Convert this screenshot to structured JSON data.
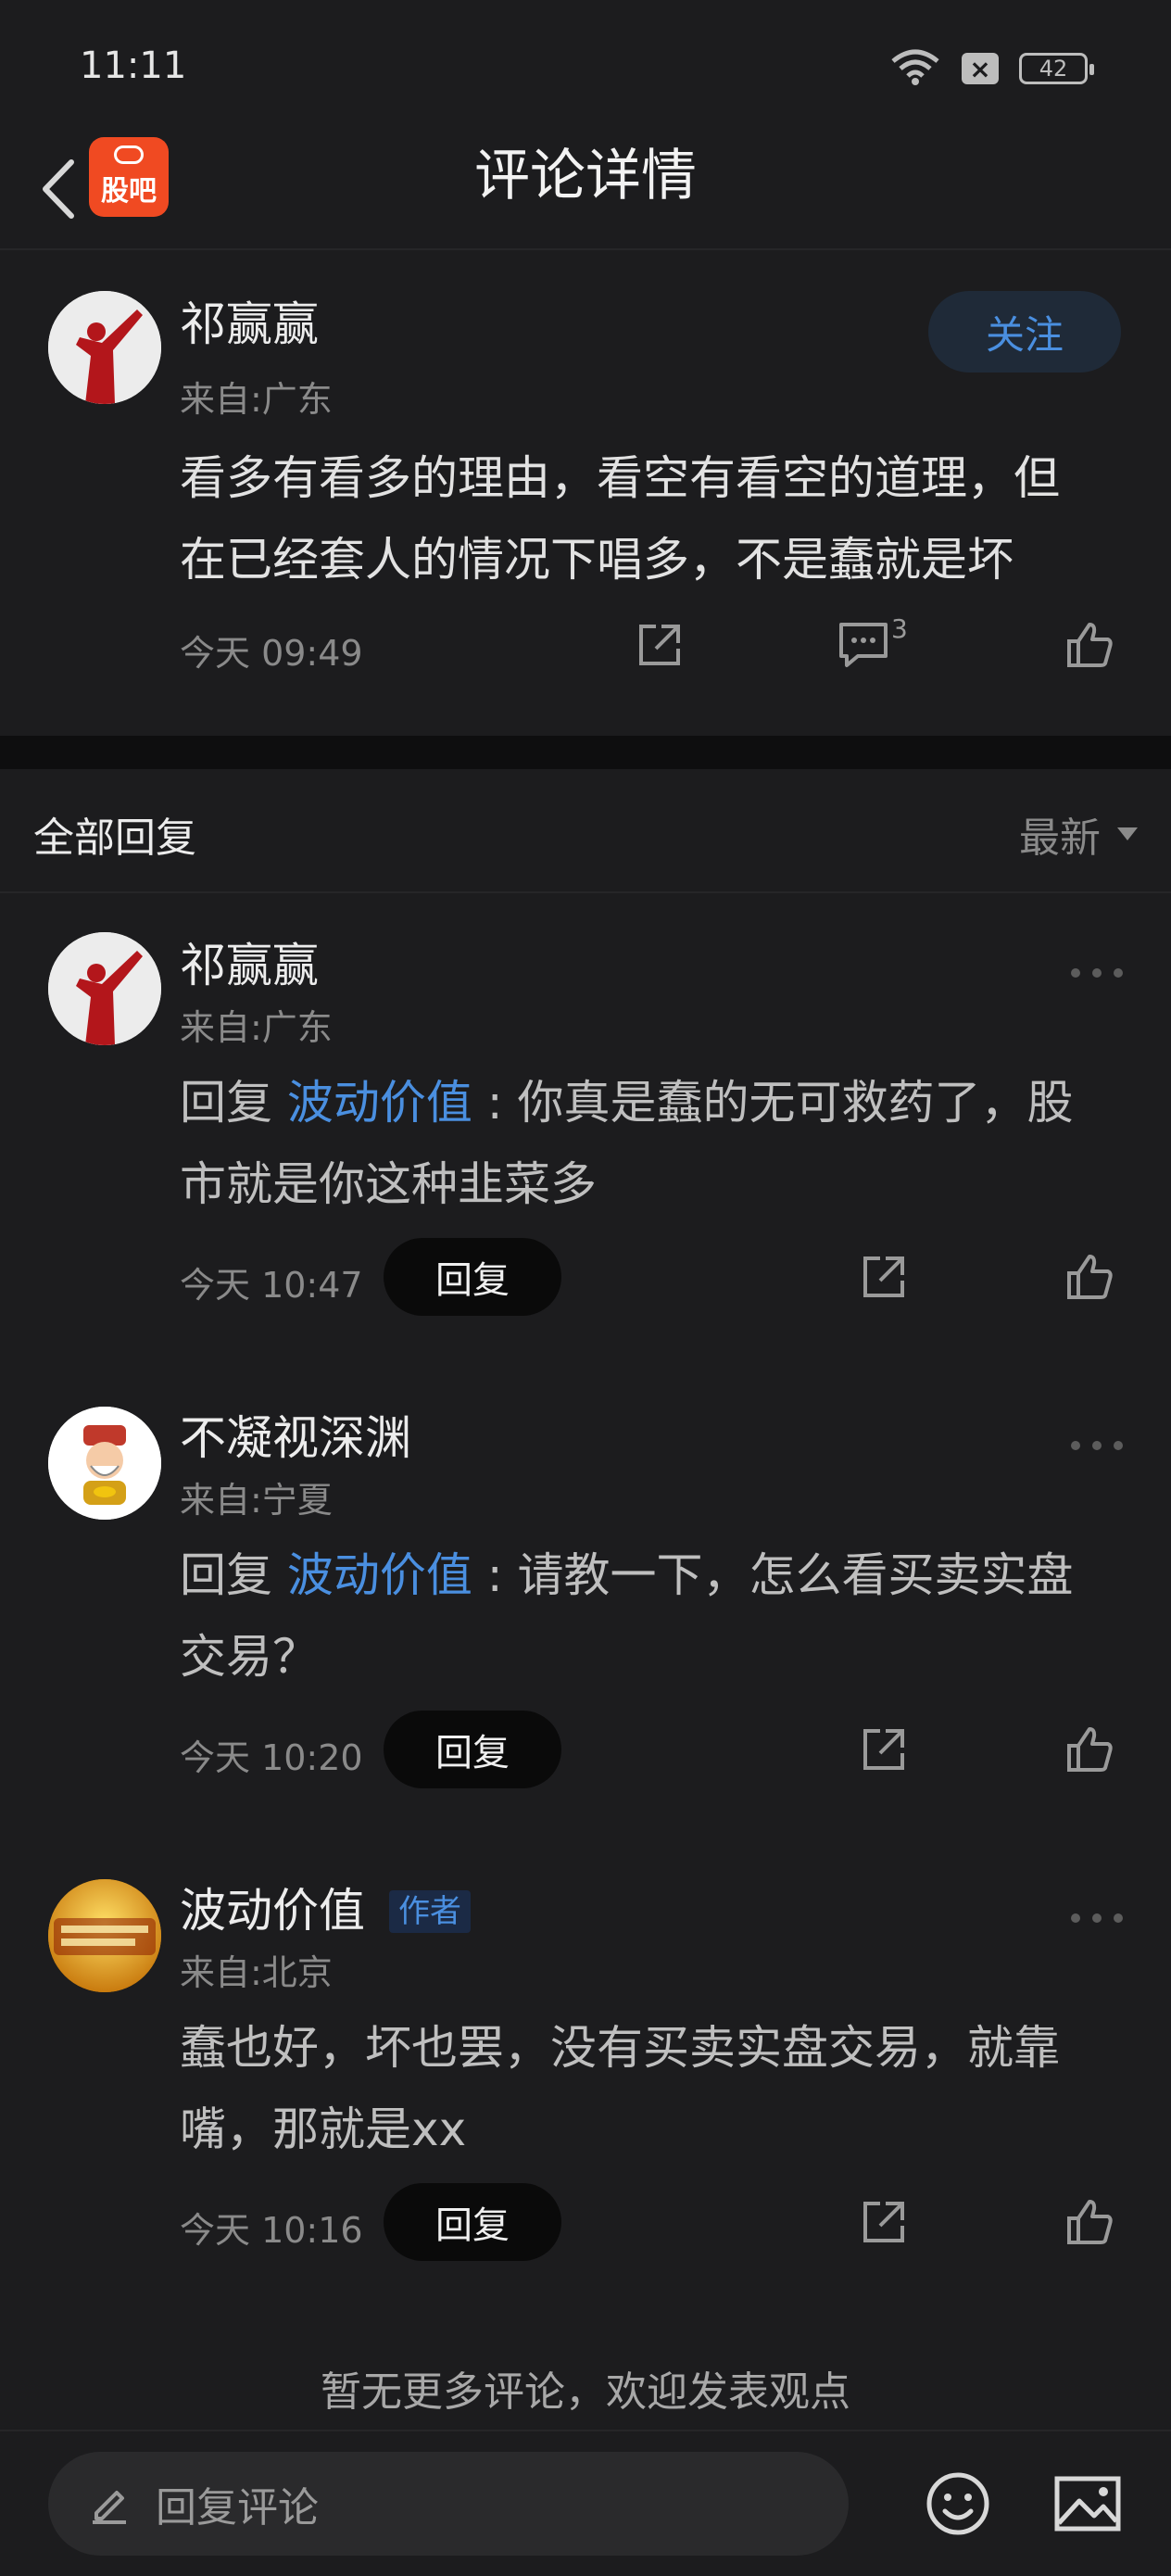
{
  "status_bar": {
    "time": "11:11",
    "battery": "42"
  },
  "header": {
    "app_badge": "股吧",
    "title": "评论详情"
  },
  "main_comment": {
    "author": "祁赢赢",
    "location": "来自:广东",
    "follow_label": "关注",
    "content_line1": "看多有看多的理由，看空有看空的道理，但",
    "content_line2": "在已经套人的情况下唱多，不是蠢就是坏",
    "time": "今天 09:49",
    "comment_count": "3"
  },
  "section": {
    "title": "全部回复",
    "sort_label": "最新"
  },
  "replies": [
    {
      "author": "祁赢赢",
      "location": "来自:广东",
      "reply_prefix": "回复 ",
      "mention": "波动价值",
      "line1_rest": " : 你真是蠢的无可救药了，股",
      "line2": "市就是你这种韭菜多",
      "time": "今天 10:47",
      "reply_label": "回复"
    },
    {
      "author": "不凝视深渊",
      "location": "来自:宁夏",
      "reply_prefix": "回复 ",
      "mention": "波动价值",
      "line1_rest": " : 请教一下，怎么看买卖实盘",
      "line2": "交易？",
      "time": "今天 10:20",
      "reply_label": "回复"
    },
    {
      "author": "波动价值",
      "author_tag": "作者",
      "location": "来自:北京",
      "line1": "蠢也好，坏也罢，没有买卖实盘交易，就靠",
      "line2": "嘴，那就是xx",
      "time": "今天 10:16",
      "reply_label": "回复"
    }
  ],
  "footer": {
    "no_more_text": "暂无更多评论，欢迎发表观点"
  },
  "bottom_bar": {
    "input_placeholder": "回复评论"
  },
  "colors": {
    "background": "#1c1c1e",
    "accent": "#4a8fe0",
    "badge": "#f04a22"
  }
}
